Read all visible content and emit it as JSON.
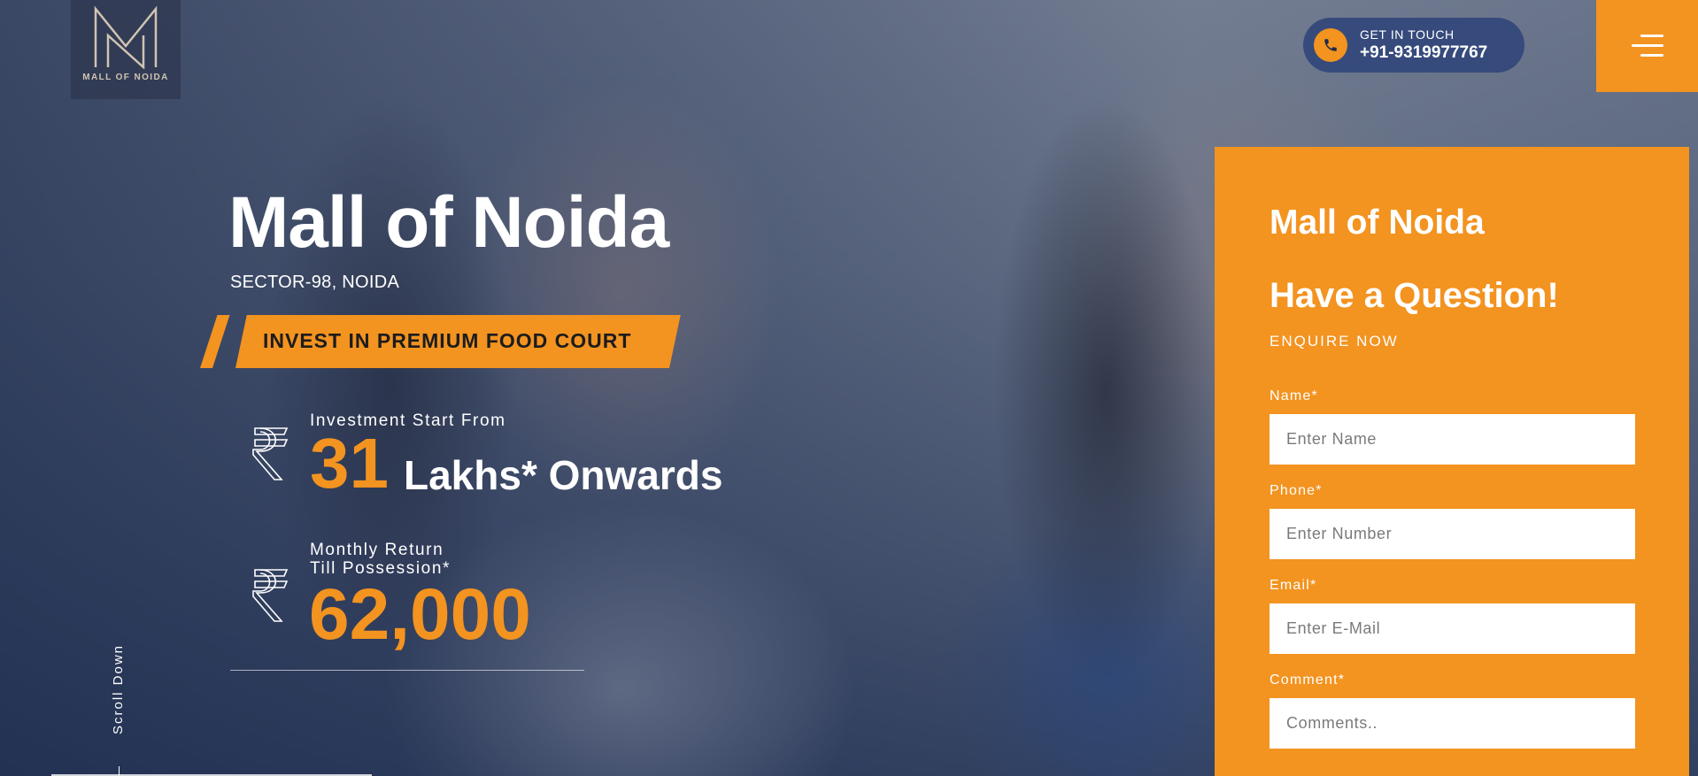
{
  "brand": {
    "logo_text": "MALL OF NOIDA"
  },
  "header": {
    "contact_label": "GET IN TOUCH",
    "contact_number": "+91-9319977767",
    "menu_icon": "hamburger-menu-icon"
  },
  "hero": {
    "title": "Mall of Noida",
    "subtitle": "SECTOR-98, NOIDA",
    "banner": "INVEST IN PREMIUM FOOD COURT",
    "stat1": {
      "label": "Investment Start From",
      "value": "31",
      "suffix": "Lakhs* Onwards",
      "icon": "rupee-icon"
    },
    "stat2": {
      "label_line1": "Monthly Return",
      "label_line2": "Till Possession*",
      "value": "62,000",
      "icon": "rupee-icon"
    },
    "scroll_label": "Scroll Down"
  },
  "form": {
    "brand": "Mall of Noida",
    "heading": "Have a Question!",
    "cta": "ENQUIRE NOW",
    "fields": [
      {
        "label": "Name*",
        "placeholder": "Enter Name"
      },
      {
        "label": "Phone*",
        "placeholder": "Enter Number"
      },
      {
        "label": "Email*",
        "placeholder": "Enter E-Mail"
      },
      {
        "label": "Comment*",
        "placeholder": "Comments.."
      }
    ]
  },
  "colors": {
    "accent": "#f39320",
    "pill": "#364a7c",
    "text": "#ffffff"
  }
}
